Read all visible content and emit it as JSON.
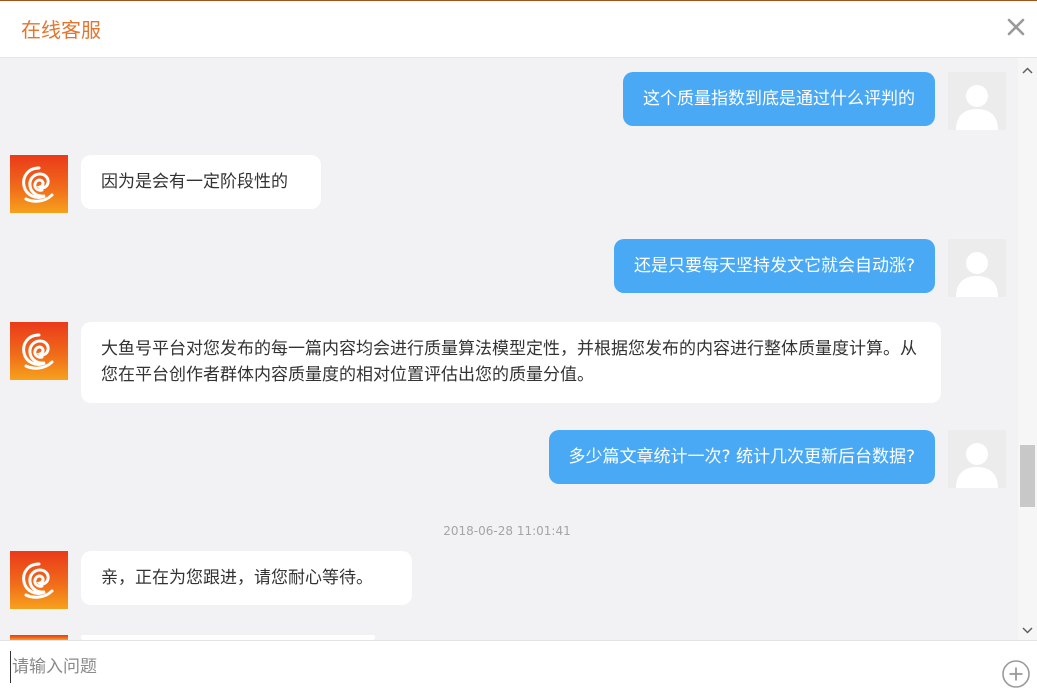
{
  "header": {
    "title": "在线客服",
    "close_icon": "close-icon"
  },
  "messages": [
    {
      "sender": "user",
      "text": "这个质量指数到底是通过什么评判的"
    },
    {
      "sender": "agent",
      "text": "因为是会有一定阶段性的"
    },
    {
      "sender": "user",
      "text": "还是只要每天坚持发文它就会自动涨?"
    },
    {
      "sender": "agent",
      "text": "大鱼号平台对您发布的每一篇内容均会进行质量算法模型定性，并根据您发布的内容进行整体质量度计算。从您在平台创作者群体内容质量度的相对位置评估出您的质量分值。"
    },
    {
      "sender": "user",
      "text": "多少篇文章统计一次? 统计几次更新后台数据?"
    },
    {
      "sender": "agent",
      "text": "亲，正在为您跟进，请您耐心等待。"
    }
  ],
  "timestamp": "2018-06-28 11:01:41",
  "input": {
    "placeholder": "请输入问题",
    "value": ""
  },
  "colors": {
    "title": "#e2762f",
    "user_bubble": "#4aa9f5",
    "agent_bubble": "#ffffff",
    "background": "#f2f2f4"
  },
  "icons": {
    "agent_avatar": "fish-logo-icon",
    "user_avatar": "default-user-avatar-icon",
    "add": "plus-circle-icon"
  }
}
